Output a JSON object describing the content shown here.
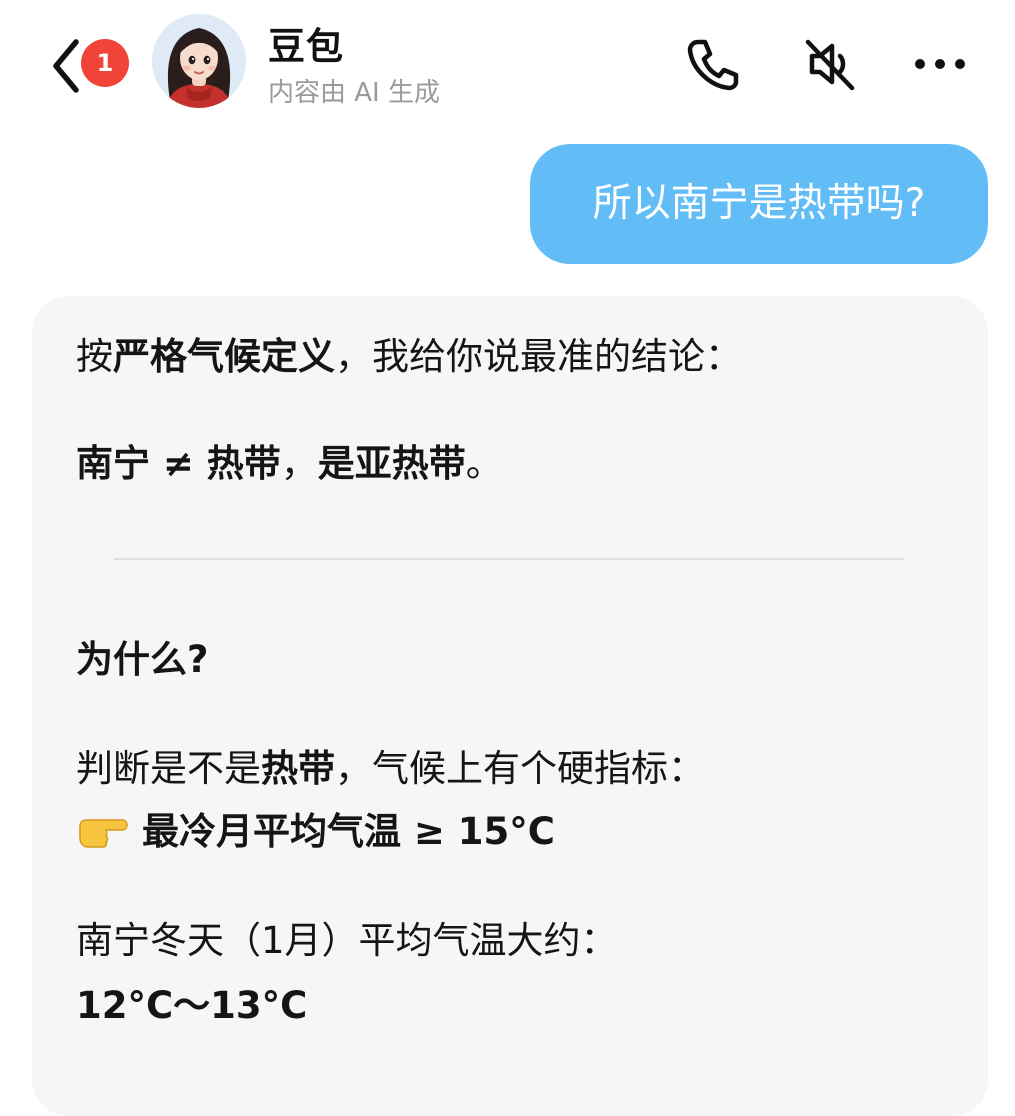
{
  "header": {
    "unread_count": "1",
    "contact_name": "豆包",
    "contact_subtitle": "内容由 AI 生成",
    "icons": {
      "back": "chevron-left-icon",
      "call": "phone-icon",
      "mute": "speaker-muted-icon",
      "more": "ellipsis-icon"
    }
  },
  "messages": {
    "user_message": "所以南宁是热带吗?",
    "ai": {
      "intro_a": "按",
      "intro_b": "严格气候定义",
      "intro_c": "，我给你说最准的结论：",
      "conclusion_a": "南宁 ≠ 热带",
      "conclusion_b": "，",
      "conclusion_c": "是亚热带",
      "conclusion_d": "。",
      "why_heading": "为什么?",
      "criterion_a": "判断是不是",
      "criterion_b": "热带",
      "criterion_c": "，气候上有个硬指标：",
      "criterion_rule": "最冷月平均气温 ≥ 15°C",
      "nanning_a": "南宁冬天（1月）平均气温大约：",
      "nanning_temp": "12°C～13°C"
    }
  },
  "colors": {
    "user_bubble": "#62bdf7",
    "ai_card": "#f6f6f6",
    "badge": "#f04438",
    "subtitle": "#9a9aa0"
  }
}
